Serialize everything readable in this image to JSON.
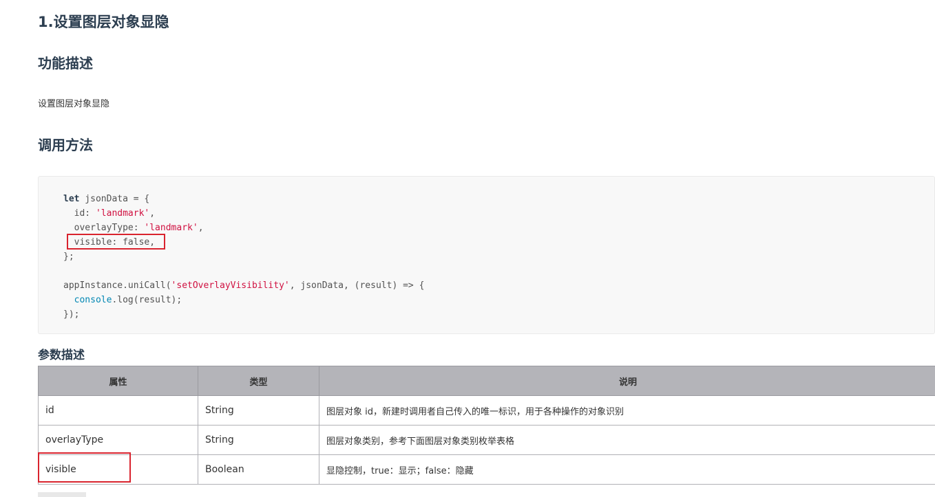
{
  "title": "1.设置图层对象显隐",
  "sections": {
    "function_desc": {
      "heading": "功能描述",
      "text": "设置图层对象显隐"
    },
    "call_method": {
      "heading": "调用方法"
    },
    "params": {
      "heading": "参数描述",
      "columns": [
        "属性",
        "类型",
        "说明"
      ],
      "rows": [
        {
          "name": "id",
          "type": "String",
          "desc": "图层对象 id，新建时调用者自己传入的唯一标识，用于各种操作的对象识别"
        },
        {
          "name": "overlayType",
          "type": "String",
          "desc": "图层对象类别，参考下面图层对象类别枚举表格"
        },
        {
          "name": "visible",
          "type": "Boolean",
          "desc": "显隐控制，true：显示；false：隐藏"
        }
      ]
    }
  },
  "code": {
    "l1_kw": "let",
    "l1_rest": " jsonData = {",
    "l2_key": "  id: ",
    "l2_val": "'landmark'",
    "l2_end": ",",
    "l3_key": "  overlayType: ",
    "l3_val": "'landmark'",
    "l3_end": ",",
    "l4": "  visible: false,",
    "l5": "};",
    "l7_a": "appInstance.uniCall(",
    "l7_str": "'setOverlayVisibility'",
    "l7_b": ", jsonData, (result) => {",
    "l8_fn": "  console",
    "l8_rest": ".log(result);",
    "l9": "});"
  },
  "colors": {
    "highlight_border": "#d9232e",
    "table_header_bg": "#b4b4b9",
    "code_bg": "#f8f8f8",
    "string": "#d01040"
  }
}
